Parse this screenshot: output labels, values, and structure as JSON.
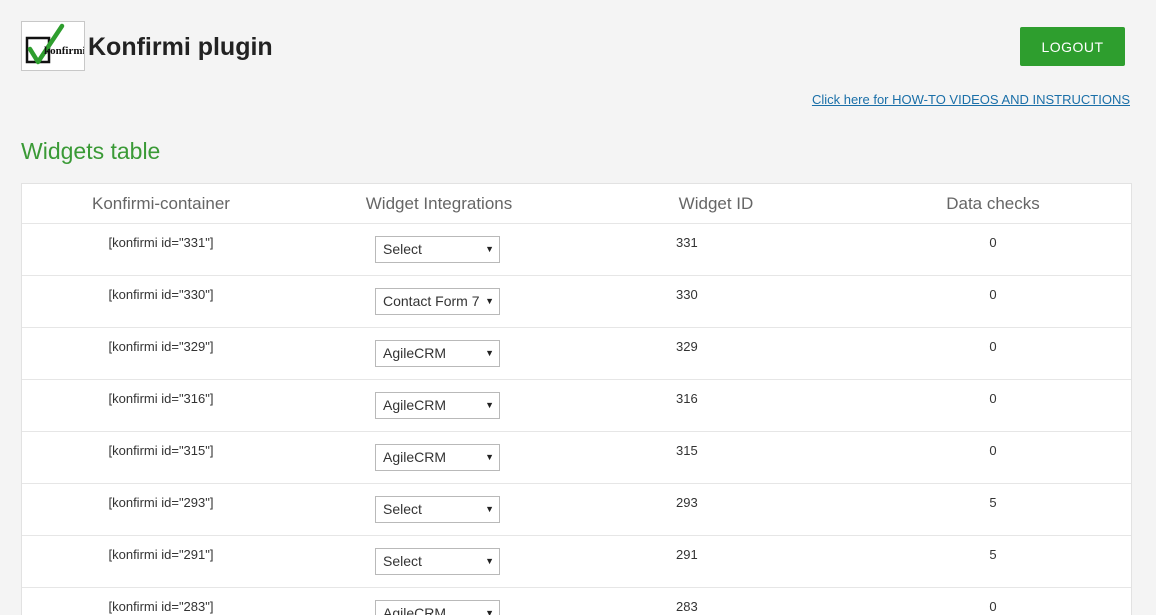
{
  "header": {
    "logo_text": "konfirmi",
    "title": "Konfirmi plugin",
    "logout_label": "LOGOUT",
    "howto_link": "Click here for HOW-TO VIDEOS AND INSTRUCTIONS"
  },
  "colors": {
    "accent_green": "#2e9e2e",
    "section_title": "#3a9a36",
    "link": "#1a6fa8"
  },
  "section_title": "Widgets table",
  "table": {
    "columns": [
      "Konfirmi-container",
      "Widget Integrations",
      "Widget ID",
      "Data checks"
    ],
    "rows": [
      {
        "container": "[konfirmi id=\"331\"]",
        "integration": "Select",
        "widget_id": "331",
        "data_checks": "0"
      },
      {
        "container": "[konfirmi id=\"330\"]",
        "integration": "Contact Form 7",
        "widget_id": "330",
        "data_checks": "0"
      },
      {
        "container": "[konfirmi id=\"329\"]",
        "integration": "AgileCRM",
        "widget_id": "329",
        "data_checks": "0"
      },
      {
        "container": "[konfirmi id=\"316\"]",
        "integration": "AgileCRM",
        "widget_id": "316",
        "data_checks": "0"
      },
      {
        "container": "[konfirmi id=\"315\"]",
        "integration": "AgileCRM",
        "widget_id": "315",
        "data_checks": "0"
      },
      {
        "container": "[konfirmi id=\"293\"]",
        "integration": "Select",
        "widget_id": "293",
        "data_checks": "5"
      },
      {
        "container": "[konfirmi id=\"291\"]",
        "integration": "Select",
        "widget_id": "291",
        "data_checks": "5"
      },
      {
        "container": "[konfirmi id=\"283\"]",
        "integration": "AgileCRM",
        "widget_id": "283",
        "data_checks": "0"
      }
    ]
  }
}
